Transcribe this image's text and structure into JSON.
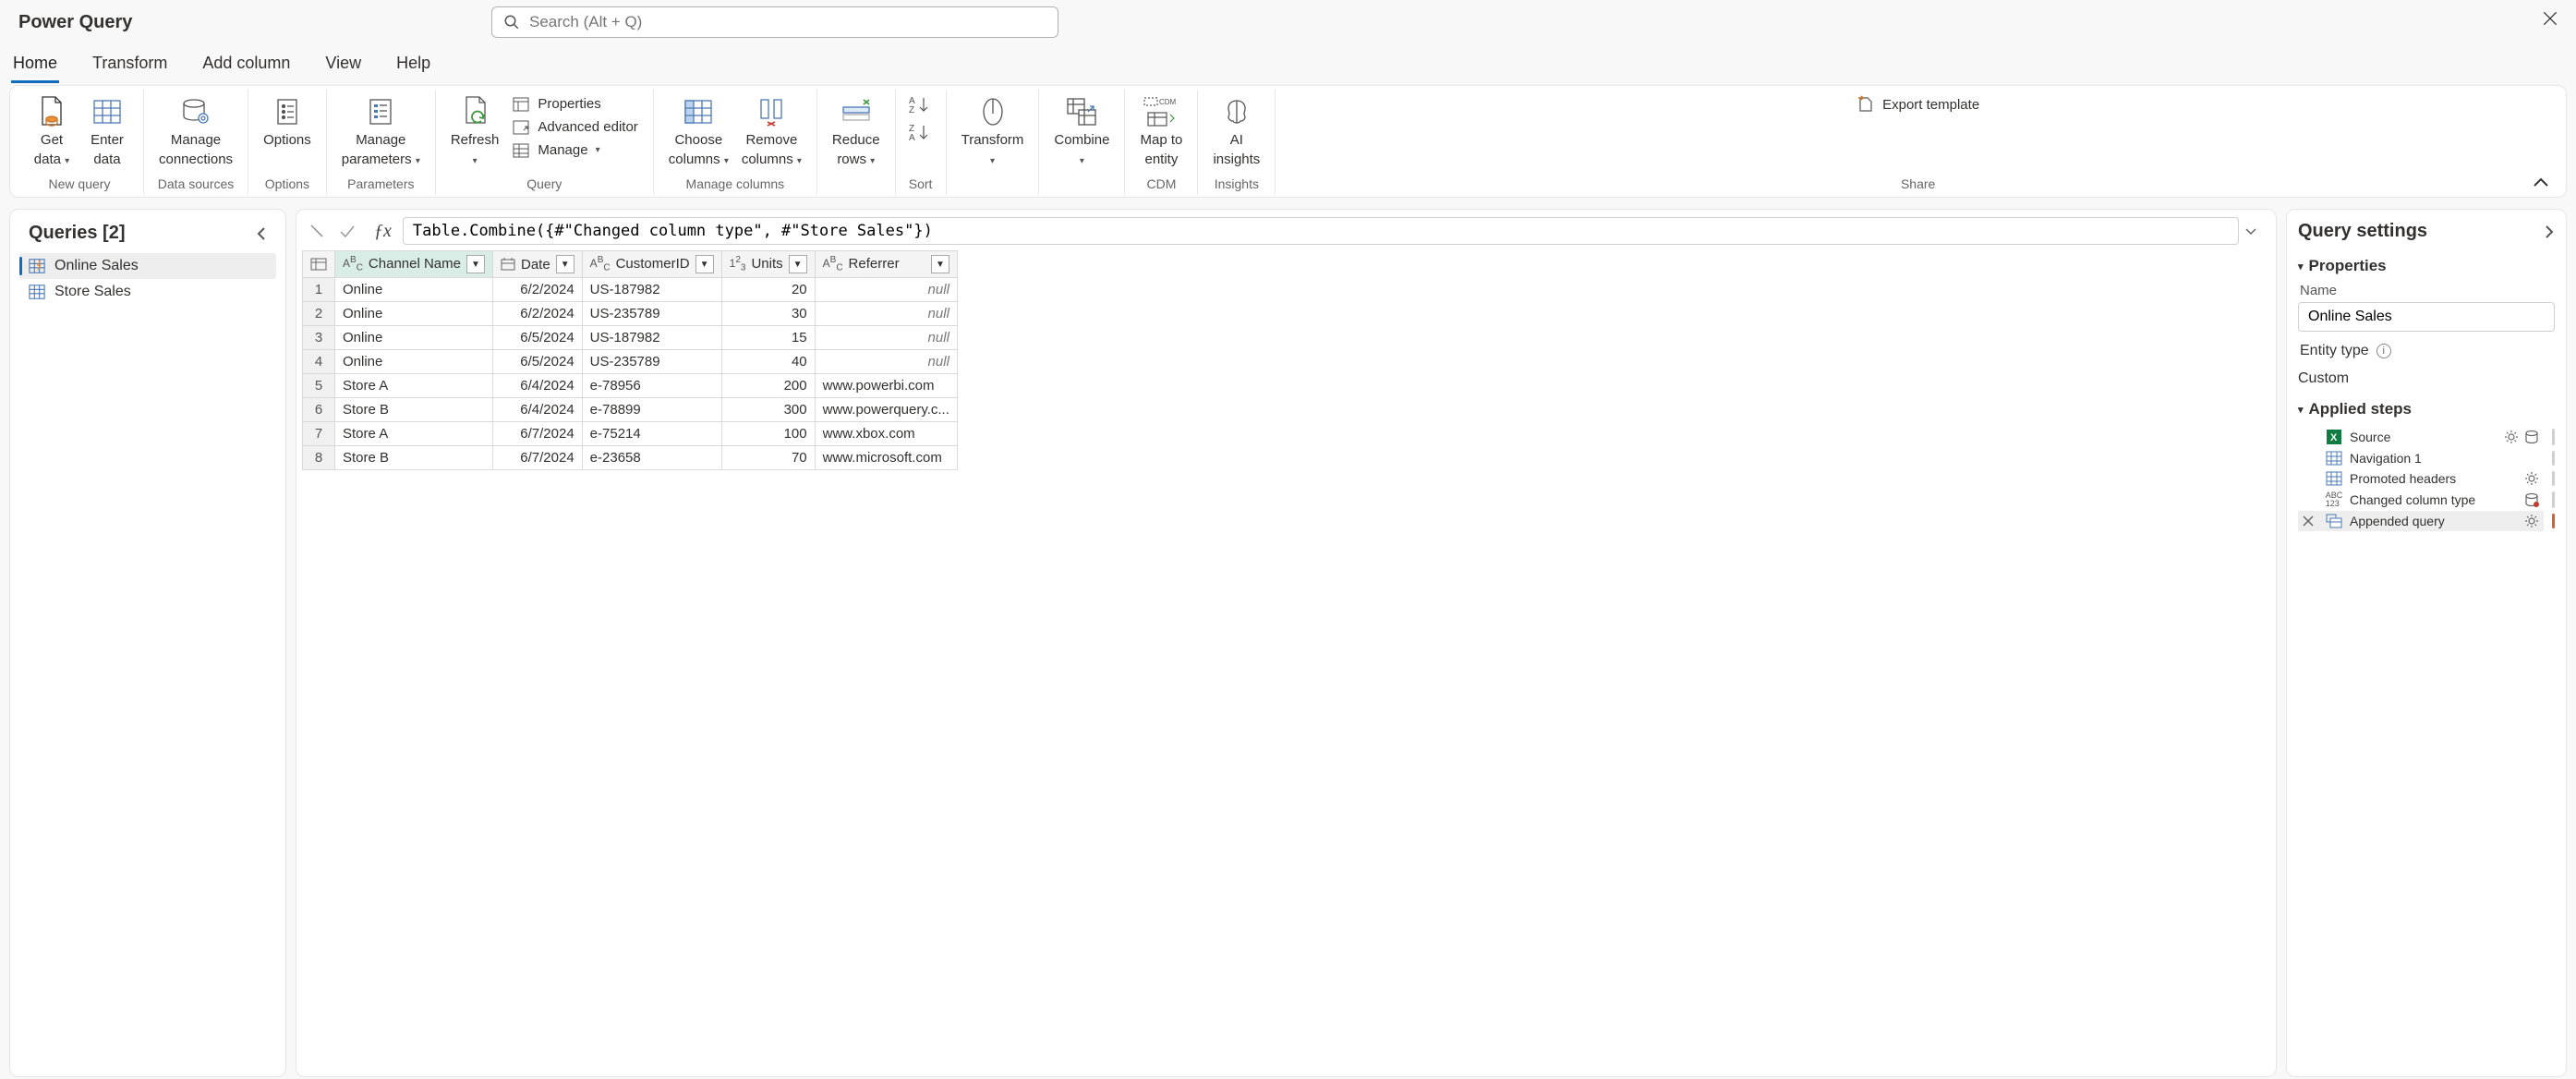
{
  "app": {
    "title": "Power Query"
  },
  "search": {
    "placeholder": "Search (Alt + Q)"
  },
  "tabs": [
    "Home",
    "Transform",
    "Add column",
    "View",
    "Help"
  ],
  "active_tab": "Home",
  "ribbon": {
    "groups": [
      {
        "label": "New query",
        "items": [
          {
            "big": true,
            "name": "get-data-button",
            "lines": [
              "Get",
              "data"
            ],
            "caret": true
          },
          {
            "big": true,
            "name": "enter-data-button",
            "lines": [
              "Enter",
              "data"
            ]
          }
        ]
      },
      {
        "label": "Data sources",
        "items": [
          {
            "big": true,
            "name": "manage-connections-button",
            "lines": [
              "Manage",
              "connections"
            ]
          }
        ]
      },
      {
        "label": "Options",
        "items": [
          {
            "big": true,
            "name": "options-button",
            "lines": [
              "Options"
            ]
          }
        ]
      },
      {
        "label": "Parameters",
        "items": [
          {
            "big": true,
            "name": "manage-parameters-button",
            "lines": [
              "Manage",
              "parameters"
            ],
            "caret": true
          }
        ]
      },
      {
        "label": "Query",
        "items": [
          {
            "big": true,
            "name": "refresh-button",
            "lines": [
              "Refresh"
            ],
            "caret_below": true
          },
          {
            "small_col": true,
            "items": [
              {
                "name": "properties-button",
                "label": "Properties"
              },
              {
                "name": "advanced-editor-button",
                "label": "Advanced editor"
              },
              {
                "name": "manage-button",
                "label": "Manage",
                "caret": true
              }
            ]
          }
        ]
      },
      {
        "label": "Manage columns",
        "items": [
          {
            "big": true,
            "name": "choose-columns-button",
            "lines": [
              "Choose",
              "columns"
            ],
            "caret": true
          },
          {
            "big": true,
            "name": "remove-columns-button",
            "lines": [
              "Remove",
              "columns"
            ],
            "caret": true
          }
        ]
      },
      {
        "label": "",
        "items": [
          {
            "big": true,
            "name": "reduce-rows-button",
            "lines": [
              "Reduce",
              "rows"
            ],
            "caret": true
          }
        ]
      },
      {
        "label": "Sort",
        "items": [
          {
            "sort_col": true,
            "name": "sort-buttons"
          }
        ]
      },
      {
        "label": "",
        "items": [
          {
            "big": true,
            "name": "transform-button",
            "lines": [
              "Transform"
            ],
            "caret_below": true
          }
        ]
      },
      {
        "label": "",
        "items": [
          {
            "big": true,
            "name": "combine-button",
            "lines": [
              "Combine"
            ],
            "caret_below": true
          }
        ]
      },
      {
        "label": "CDM",
        "items": [
          {
            "big": true,
            "name": "map-to-entity-button",
            "lines": [
              "Map to",
              "entity"
            ]
          }
        ]
      },
      {
        "label": "Insights",
        "items": [
          {
            "big": true,
            "name": "ai-insights-button",
            "lines": [
              "AI",
              "insights"
            ]
          }
        ]
      },
      {
        "label": "Share",
        "items": [
          {
            "small_col": true,
            "items": [
              {
                "name": "export-template-button",
                "label": "Export template"
              }
            ]
          }
        ]
      }
    ]
  },
  "queries_panel": {
    "title": "Queries [2]",
    "items": [
      {
        "name": "Online Sales",
        "active": true
      },
      {
        "name": "Store Sales",
        "active": false
      }
    ]
  },
  "formula": "Table.Combine({#\"Changed column type\", #\"Store Sales\"})",
  "table": {
    "columns": [
      {
        "name": "Channel Name",
        "type": "text",
        "selected": true
      },
      {
        "name": "Date",
        "type": "date"
      },
      {
        "name": "CustomerID",
        "type": "text"
      },
      {
        "name": "Units",
        "type": "number"
      },
      {
        "name": "Referrer",
        "type": "text"
      }
    ],
    "rows": [
      {
        "n": 1,
        "Channel Name": "Online",
        "Date": "6/2/2024",
        "CustomerID": "US-187982",
        "Units": 20,
        "Referrer": null
      },
      {
        "n": 2,
        "Channel Name": "Online",
        "Date": "6/2/2024",
        "CustomerID": "US-235789",
        "Units": 30,
        "Referrer": null
      },
      {
        "n": 3,
        "Channel Name": "Online",
        "Date": "6/5/2024",
        "CustomerID": "US-187982",
        "Units": 15,
        "Referrer": null
      },
      {
        "n": 4,
        "Channel Name": "Online",
        "Date": "6/5/2024",
        "CustomerID": "US-235789",
        "Units": 40,
        "Referrer": null
      },
      {
        "n": 5,
        "Channel Name": "Store A",
        "Date": "6/4/2024",
        "CustomerID": "e-78956",
        "Units": 200,
        "Referrer": "www.powerbi.com"
      },
      {
        "n": 6,
        "Channel Name": "Store B",
        "Date": "6/4/2024",
        "CustomerID": "e-78899",
        "Units": 300,
        "Referrer": "www.powerquery.c..."
      },
      {
        "n": 7,
        "Channel Name": "Store A",
        "Date": "6/7/2024",
        "CustomerID": "e-75214",
        "Units": 100,
        "Referrer": "www.xbox.com"
      },
      {
        "n": 8,
        "Channel Name": "Store B",
        "Date": "6/7/2024",
        "CustomerID": "e-23658",
        "Units": 70,
        "Referrer": "www.microsoft.com"
      }
    ]
  },
  "settings": {
    "title": "Query settings",
    "properties_label": "Properties",
    "name_label": "Name",
    "name_value": "Online Sales",
    "entity_type_label": "Entity type",
    "entity_type_value": "Custom",
    "applied_steps_label": "Applied steps",
    "steps": [
      {
        "name": "Source",
        "icon": "excel",
        "gear": true,
        "db": true
      },
      {
        "name": "Navigation 1",
        "icon": "table"
      },
      {
        "name": "Promoted headers",
        "icon": "table",
        "gear": true
      },
      {
        "name": "Changed column type",
        "icon": "abc123",
        "db": true
      },
      {
        "name": "Appended query",
        "icon": "append",
        "gear": true,
        "active": true,
        "deletable": true
      }
    ]
  }
}
